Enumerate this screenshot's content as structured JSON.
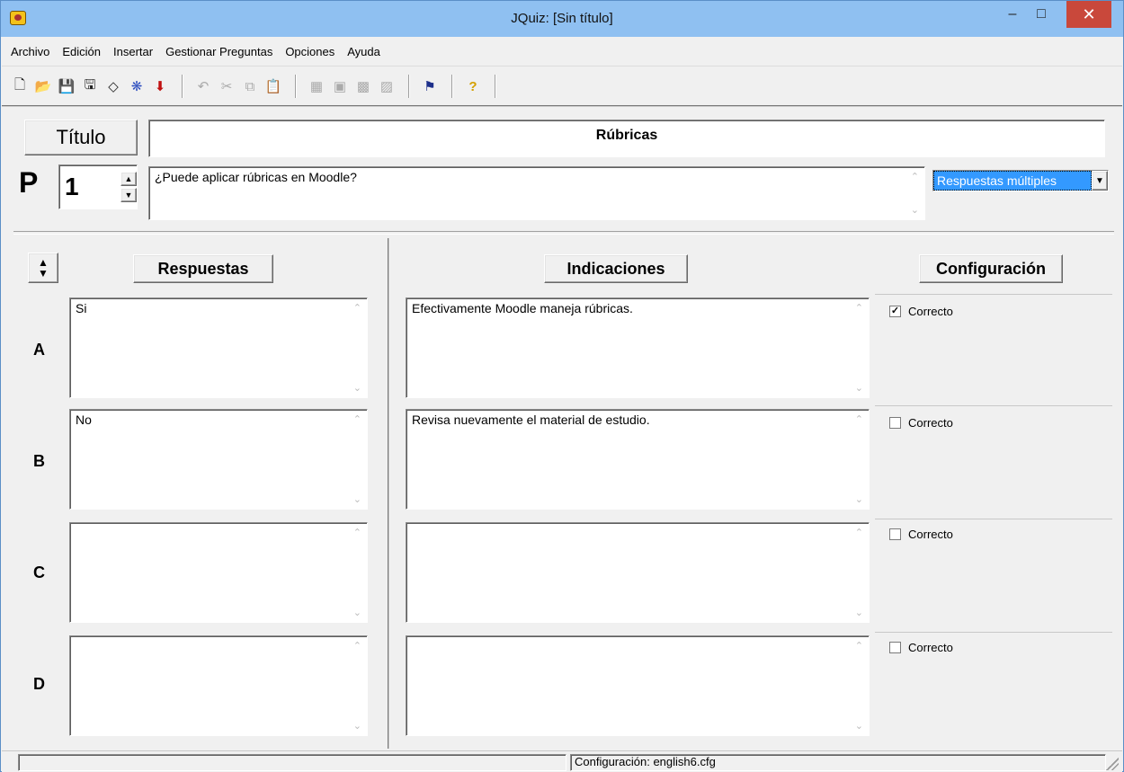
{
  "window": {
    "title": "JQuiz: [Sin título]"
  },
  "menu": [
    {
      "label": "Archivo"
    },
    {
      "label": "Edición"
    },
    {
      "label": "Insertar"
    },
    {
      "label": "Gestionar Preguntas"
    },
    {
      "label": "Opciones"
    },
    {
      "label": "Ayuda"
    }
  ],
  "toolbar": {
    "icons": [
      "new-file-icon",
      "open-folder-icon",
      "save-icon",
      "save-as-icon",
      "web-page-icon",
      "flash-icon",
      "export-icon",
      "undo-icon",
      "cut-icon",
      "copy-icon",
      "paste-icon",
      "add-question-icon",
      "delete-question-icon",
      "insert-link-icon",
      "insert-image-icon",
      "config-icon",
      "help-icon"
    ]
  },
  "header": {
    "title_button": "Título",
    "title_value": "Rúbricas",
    "question_label": "P",
    "question_number": "1",
    "question_text": "¿Puede aplicar rúbricas en Moodle?",
    "question_type": "Respuestas múltiples"
  },
  "columns": {
    "respuestas": "Respuestas",
    "indicaciones": "Indicaciones",
    "configuracion": "Configuración"
  },
  "rows": [
    {
      "letter": "A",
      "answer": "Si",
      "feedback": "Efectivamente Moodle maneja rúbricas.",
      "correct_label": "Correcto",
      "correct": true
    },
    {
      "letter": "B",
      "answer": "No",
      "feedback": "Revisa nuevamente el material de estudio.",
      "correct_label": "Correcto",
      "correct": false
    },
    {
      "letter": "C",
      "answer": "",
      "feedback": "",
      "correct_label": "Correcto",
      "correct": false
    },
    {
      "letter": "D",
      "answer": "",
      "feedback": "",
      "correct_label": "Correcto",
      "correct": false
    }
  ],
  "status": {
    "config_file": "Configuración: english6.cfg"
  }
}
